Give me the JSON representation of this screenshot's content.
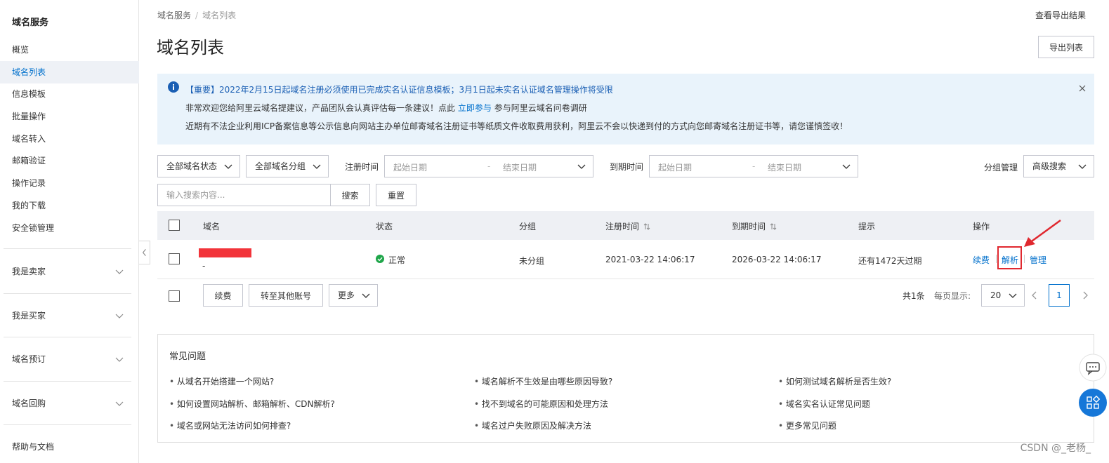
{
  "sidebar": {
    "title": "域名服务",
    "items": [
      "概览",
      "域名列表",
      "信息模板",
      "批量操作",
      "域名转入",
      "邮箱验证",
      "操作记录",
      "我的下载",
      "安全锁管理"
    ],
    "groups": [
      "我是卖家",
      "我是买家",
      "域名预订",
      "域名回购"
    ],
    "footer": "帮助与文档"
  },
  "breadcrumb": {
    "root": "域名服务",
    "sep": "/",
    "current": "域名列表"
  },
  "header": {
    "title": "域名列表",
    "top_link": "查看导出结果",
    "export_label": "导出列表"
  },
  "notice": {
    "line1": "【重要】2022年2月15日起域名注册必须使用已完成实名认证信息模板；3月1日起未实名认证域名管理操作将受限",
    "line2_pre": "非常欢迎您给阿里云域名提建议，产品团队会认真评估每一条建议！点此",
    "line2_link": "立即参与",
    "line2_post": "参与阿里云域名问卷调研",
    "line3": "近期有不法企业利用ICP备案信息等公示信息向网站主办单位邮寄域名注册证书等纸质文件收取费用获利，阿里云不会以快递到付的方式向您邮寄域名注册证书等，请您谨慎签收！"
  },
  "filters": {
    "status_select": "全部域名状态",
    "group_select": "全部域名分组",
    "reg_label": "注册时间",
    "exp_label": "到期时间",
    "start_ph": "起始日期",
    "end_ph": "结束日期",
    "range_sep": "-",
    "group_manage": "分组管理",
    "advanced": "高级搜索",
    "search_placeholder": "输入搜索内容...",
    "search_btn": "搜索",
    "reset_btn": "重置"
  },
  "table": {
    "headers": {
      "domain": "域名",
      "status": "状态",
      "group": "分组",
      "reg_time": "注册时间",
      "exp_time": "到期时间",
      "hint": "提示",
      "ops": "操作"
    },
    "row": {
      "domain_sub": "-",
      "status": "正常",
      "group": "未分组",
      "reg_time": "2021-03-22 14:06:17",
      "exp_time": "2026-03-22 14:06:17",
      "hint": "还有1472天过期",
      "op_renew": "续费",
      "op_dns": "解析",
      "op_manage": "管理"
    }
  },
  "batch": {
    "renew": "续费",
    "transfer": "转至其他账号",
    "more": "更多"
  },
  "pager": {
    "total": "共1条",
    "per_page_label": "每页显示:",
    "per_page": "20",
    "page": "1"
  },
  "faq": {
    "title": "常见问题",
    "questions": [
      "从域名开始搭建一个网站?",
      "域名解析不生效是由哪些原因导致?",
      "如何测试域名解析是否生效?",
      "如何设置网站解析、邮箱解析、CDN解析?",
      "找不到域名的可能原因和处理方法",
      "域名实名认证常见问题",
      "域名或网站无法访问如何排查?",
      "域名过户失败原因及解决方法",
      "更多常见问题"
    ]
  },
  "watermark": "CSDN @_老杨_",
  "colors": {
    "link": "#0070cc",
    "notice_bg": "#e9f3fb",
    "ok": "#1fa64a",
    "annotation": "#e0282f"
  }
}
